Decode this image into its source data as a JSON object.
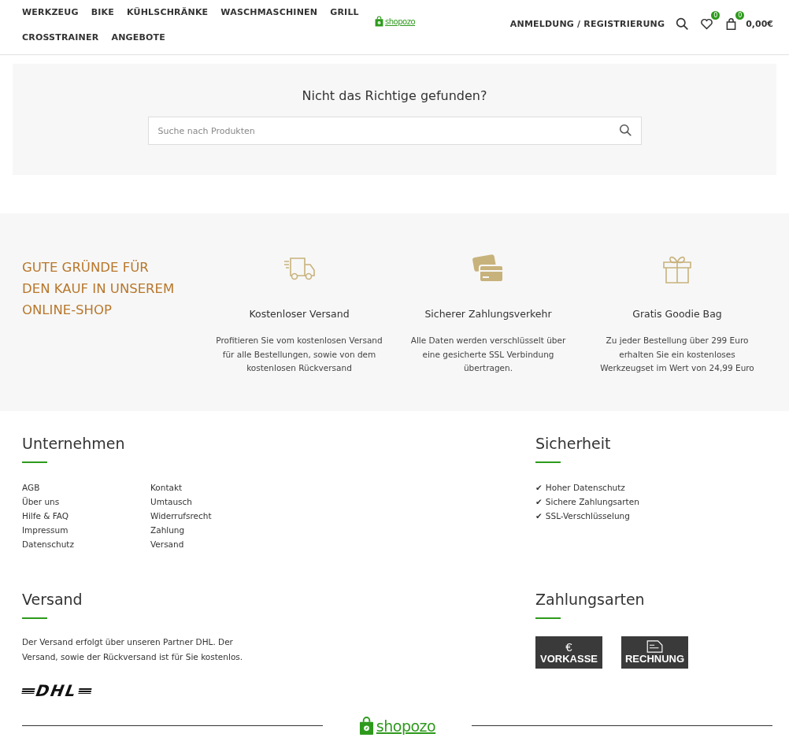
{
  "nav": {
    "menu": [
      "WERKZEUG",
      "BIKE",
      "KÜHLSCHRÄNKE",
      "WASCHMASCHINEN",
      "GRILL",
      "CROSSTRAINER",
      "ANGEBOTE"
    ],
    "logo": "shopozo",
    "account": "ANMELDUNG / REGISTRIERUNG",
    "wishlist_count": "0",
    "cart_count": "0",
    "cart_total": "0,00€"
  },
  "search_section": {
    "title": "Nicht das Richtige gefunden?",
    "placeholder": "Suche nach Produkten"
  },
  "reasons": {
    "heading": [
      "GUTE GRÜNDE FÜR",
      "DEN KAUF IN UNSEREM",
      "ONLINE-SHOP"
    ],
    "items": [
      {
        "kind": "truck",
        "title": "Kostenloser Versand",
        "text": [
          "Profitieren Sie vom kostenlosen Versand",
          "für alle Bestellungen, sowie von dem",
          "kostenlosen Rückversand"
        ]
      },
      {
        "kind": "card",
        "title": "Sicherer Zahlungsverkehr",
        "text": [
          "Alle Daten werden verschlüsselt über",
          "eine gesicherte SSL Verbindung",
          "übertragen."
        ]
      },
      {
        "kind": "gift",
        "title": "Gratis Goodie Bag",
        "text": [
          "Zu jeder Bestellung über 299 Euro",
          "erhalten Sie ein kostenloses",
          "Werkzeugset im Wert von 24,99 Euro"
        ]
      }
    ]
  },
  "footer": {
    "company": {
      "title": "Unternehmen",
      "links_1": [
        "AGB",
        "Über uns",
        "Hilfe & FAQ",
        "Impressum",
        "Datenschutz"
      ],
      "links_2": [
        "Kontakt",
        "Umtausch",
        "Widerrufsrecht",
        "Zahlung",
        "Versand"
      ]
    },
    "security": {
      "title": "Sicherheit",
      "items": [
        {
          "check": "✔",
          "text": "Hoher Datenschutz"
        },
        {
          "check": "✔",
          "text": "Sichere Zahlungsarten"
        },
        {
          "check": "✔",
          "text": "SSL-Verschlüsselung"
        }
      ]
    },
    "shipping": {
      "title": "Versand",
      "text": [
        "Der Versand erfolgt über unseren Partner DHL. Der",
        "Versand, sowie der Rückversand ist für Sie kostenlos."
      ],
      "carrier_logo": "DHL"
    },
    "payment": {
      "title": "Zahlungsarten",
      "methods": [
        {
          "kind": "euro",
          "symbol": "€",
          "label": "VORKASSE"
        },
        {
          "kind": "invoice",
          "label": "RECHNUNG"
        }
      ]
    },
    "bottom_logo": "shopozo"
  }
}
